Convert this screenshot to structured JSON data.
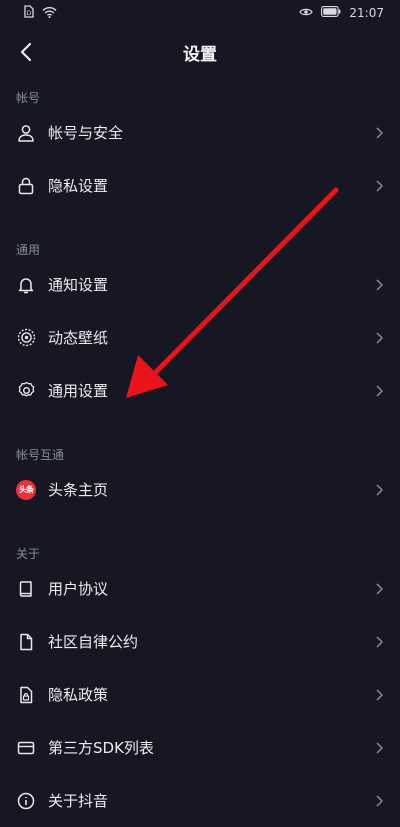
{
  "status": {
    "time": "21:07"
  },
  "header": {
    "title": "设置"
  },
  "sections": [
    {
      "title": "帐号",
      "items": [
        {
          "label": "帐号与安全",
          "icon": "person-icon"
        },
        {
          "label": "隐私设置",
          "icon": "lock-icon"
        }
      ]
    },
    {
      "title": "通用",
      "items": [
        {
          "label": "通知设置",
          "icon": "bell-icon"
        },
        {
          "label": "动态壁纸",
          "icon": "wallpaper-icon"
        },
        {
          "label": "通用设置",
          "icon": "gear-icon"
        }
      ]
    },
    {
      "title": "帐号互通",
      "items": [
        {
          "label": "头条主页",
          "icon": "toutiao-logo",
          "badge": "头条"
        }
      ]
    },
    {
      "title": "关于",
      "items": [
        {
          "label": "用户协议",
          "icon": "book-icon"
        },
        {
          "label": "社区自律公约",
          "icon": "document-icon"
        },
        {
          "label": "隐私政策",
          "icon": "privacy-doc-icon"
        },
        {
          "label": "第三方SDK列表",
          "icon": "card-icon"
        },
        {
          "label": "关于抖音",
          "icon": "info-icon"
        }
      ]
    }
  ],
  "colors": {
    "background": "#161722",
    "annotation_arrow": "#e8141b"
  }
}
